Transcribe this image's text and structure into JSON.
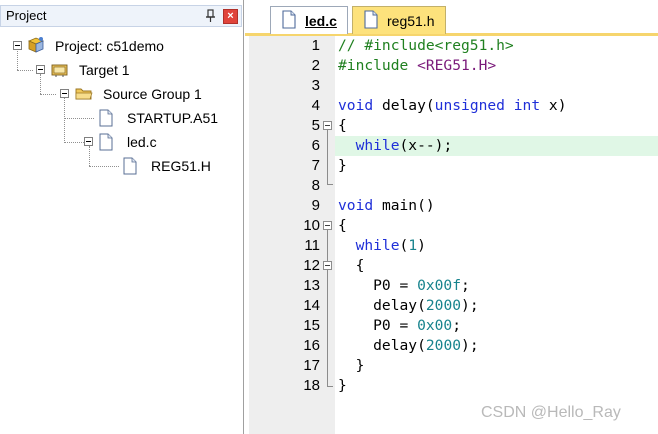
{
  "project_panel": {
    "title": "Project",
    "close_symbol": "×",
    "tree": {
      "project": "Project: c51demo",
      "target": "Target 1",
      "group": "Source Group 1",
      "files": [
        "STARTUP.A51",
        "led.c"
      ],
      "child": "REG51.H"
    }
  },
  "tabs": [
    {
      "label": "led.c",
      "active": true
    },
    {
      "label": "reg51.h",
      "active": false
    }
  ],
  "editor": {
    "line_numbers": [
      "1",
      "2",
      "3",
      "4",
      "5",
      "6",
      "7",
      "8",
      "9",
      "10",
      "11",
      "12",
      "13",
      "14",
      "15",
      "16",
      "17",
      "18"
    ],
    "highlighted_line": 6,
    "tokens": {
      "l1_comment": "// #include<reg51.h>",
      "l2_pre": "#include ",
      "l2_file": "<REG51.H>",
      "l4_void": "void",
      "l4_name": " delay(",
      "l4_unsigned": "unsigned",
      "l4_sp": " ",
      "l4_int": "int",
      "l4_rest": " x)",
      "l5": "{",
      "l6_indent": "  ",
      "l6_while": "while",
      "l6_rest": "(x--);",
      "l7": "}",
      "l9_void": "void",
      "l9_rest": " main()",
      "l10": "{",
      "l11_indent": "  ",
      "l11_while": "while",
      "l11_open": "(",
      "l11_num": "1",
      "l11_close": ")",
      "l12": "  {",
      "l13_a": "    P0 = ",
      "l13_num": "0x00f",
      "l13_b": ";",
      "l14_a": "    delay(",
      "l14_num": "2000",
      "l14_b": ");",
      "l15_a": "    P0 = ",
      "l15_num": "0x00",
      "l15_b": ";",
      "l16_a": "    delay(",
      "l16_num": "2000",
      "l16_b": ");",
      "l17": "  }",
      "l18": "}"
    }
  },
  "watermark": "CSDN @Hello_Ray",
  "colors": {
    "keyword": "#1f2fd8",
    "comment": "#208020",
    "number": "#17838d",
    "include_file": "#7a1a7a",
    "active_line": "#e0f7e6",
    "tab_inactive": "#fde27c"
  },
  "icons": [
    "pin-icon",
    "close-icon",
    "project-icon",
    "target-icon",
    "folder-icon",
    "file-icon"
  ]
}
